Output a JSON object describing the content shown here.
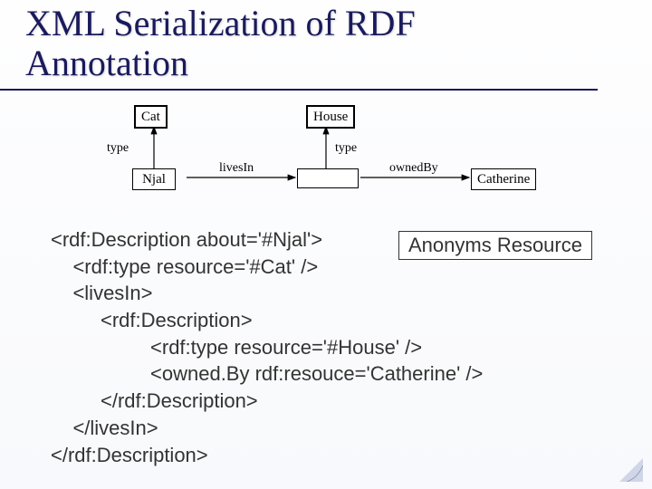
{
  "title_line1": "XML Serialization of RDF",
  "title_line2": "Annotation",
  "diagram": {
    "box_cat": "Cat",
    "box_house": "House",
    "box_njal": "Njal",
    "box_blank": "",
    "box_catherine": "Catherine",
    "edge_type_left": "type",
    "edge_type_right": "type",
    "edge_livesIn": "livesIn",
    "edge_ownedBy": "ownedBy"
  },
  "annotation": "Anonyms Resource",
  "code": {
    "l1": "<rdf:Description about='#Njal'>",
    "l2": "    <rdf:type resource='#Cat' />",
    "l3": "    <livesIn>",
    "l4": "         <rdf:Description>",
    "l5": "                  <rdf:type resource='#House' />",
    "l6": "                  <owned.By rdf:resouce='Catherine' />",
    "l7": "         </rdf:Description>",
    "l8": "    </livesIn>",
    "l9": "</rdf:Description>"
  }
}
